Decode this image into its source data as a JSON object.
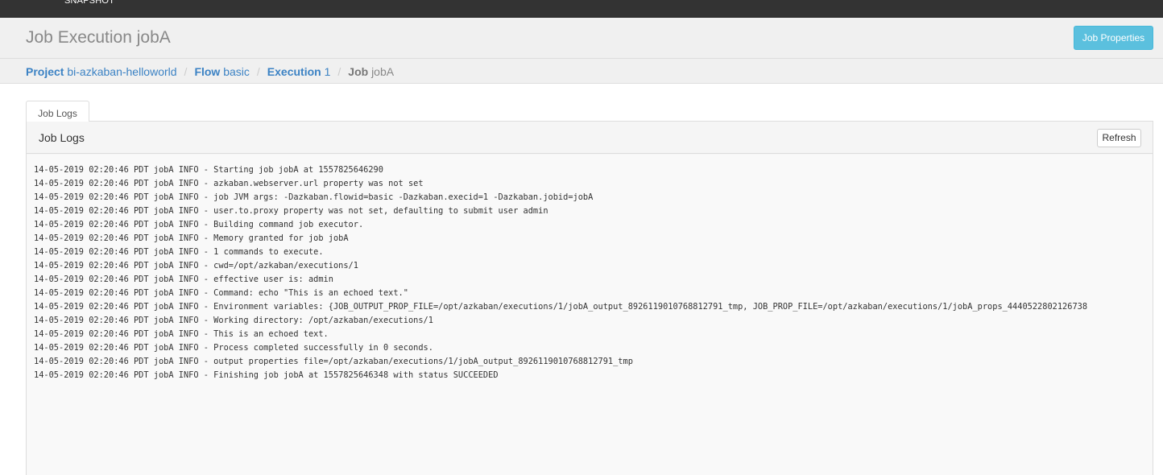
{
  "navbar": {
    "version_text": "SNAPSHOT"
  },
  "header": {
    "title": "Job Execution jobA",
    "job_properties_label": "Job Properties"
  },
  "breadcrumb": {
    "project": {
      "key": "Project",
      "value": "bi-azkaban-helloworld"
    },
    "flow": {
      "key": "Flow",
      "value": "basic"
    },
    "execution": {
      "key": "Execution",
      "value": "1"
    },
    "job": {
      "key": "Job",
      "value": "jobA"
    },
    "separator": "/"
  },
  "tabs": [
    {
      "label": "Job Logs",
      "active": true
    }
  ],
  "panel": {
    "title": "Job Logs",
    "refresh_label": "Refresh",
    "log_lines": [
      "14-05-2019 02:20:46 PDT jobA INFO - Starting job jobA at 1557825646290",
      "14-05-2019 02:20:46 PDT jobA INFO - azkaban.webserver.url property was not set",
      "14-05-2019 02:20:46 PDT jobA INFO - job JVM args: -Dazkaban.flowid=basic -Dazkaban.execid=1 -Dazkaban.jobid=jobA",
      "14-05-2019 02:20:46 PDT jobA INFO - user.to.proxy property was not set, defaulting to submit user admin",
      "14-05-2019 02:20:46 PDT jobA INFO - Building command job executor.",
      "14-05-2019 02:20:46 PDT jobA INFO - Memory granted for job jobA",
      "14-05-2019 02:20:46 PDT jobA INFO - 1 commands to execute.",
      "14-05-2019 02:20:46 PDT jobA INFO - cwd=/opt/azkaban/executions/1",
      "14-05-2019 02:20:46 PDT jobA INFO - effective user is: admin",
      "14-05-2019 02:20:46 PDT jobA INFO - Command: echo \"This is an echoed text.\"",
      "14-05-2019 02:20:46 PDT jobA INFO - Environment variables: {JOB_OUTPUT_PROP_FILE=/opt/azkaban/executions/1/jobA_output_8926119010768812791_tmp, JOB_PROP_FILE=/opt/azkaban/executions/1/jobA_props_4440522802126738",
      "14-05-2019 02:20:46 PDT jobA INFO - Working directory: /opt/azkaban/executions/1",
      "14-05-2019 02:20:46 PDT jobA INFO - This is an echoed text.",
      "14-05-2019 02:20:46 PDT jobA INFO - Process completed successfully in 0 seconds.",
      "14-05-2019 02:20:46 PDT jobA INFO - output properties file=/opt/azkaban/executions/1/jobA_output_8926119010768812791_tmp",
      "14-05-2019 02:20:46 PDT jobA INFO - Finishing job jobA at 1557825646348 with status SUCCEEDED"
    ]
  },
  "colors": {
    "navbar_bg": "#333333",
    "header_bg": "#f0f0f0",
    "link": "#3b82c4",
    "info_button": "#5bc0de",
    "title_text": "#888888"
  }
}
